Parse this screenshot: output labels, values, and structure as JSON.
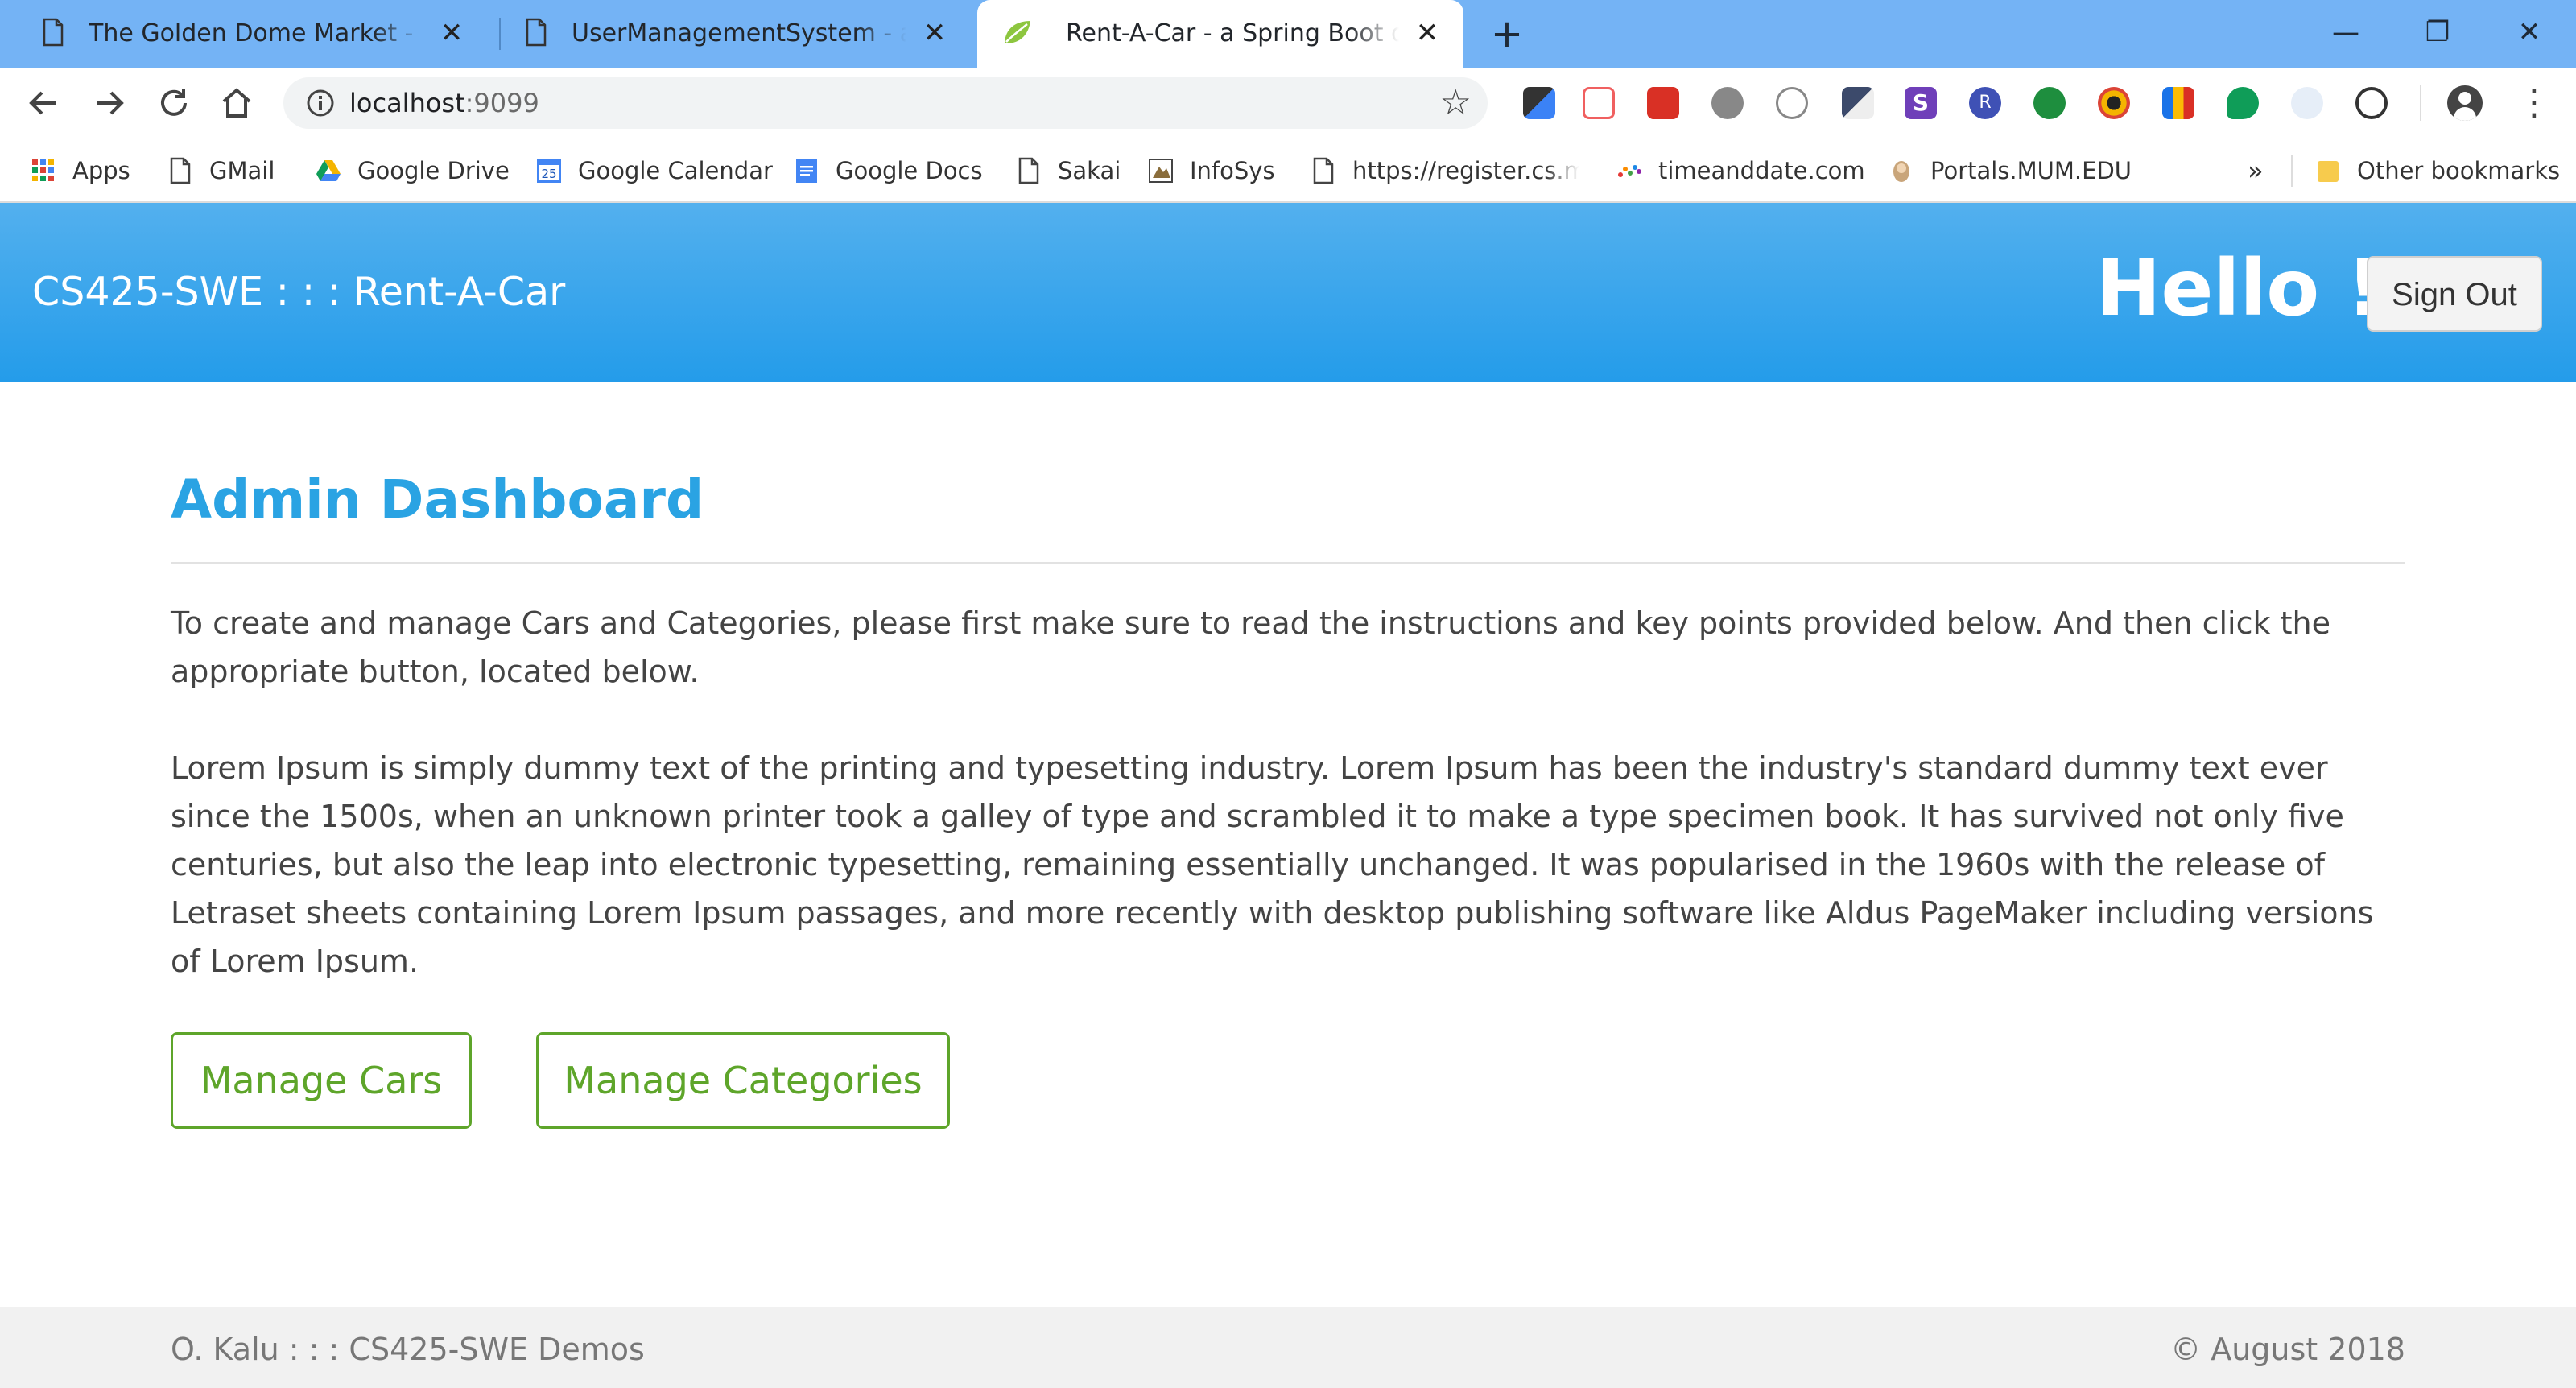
{
  "browser": {
    "tabs": [
      {
        "title": "The Golden Dome Market - SRM",
        "close": "✕"
      },
      {
        "title": "UserManagementSystem - a cust",
        "close": "✕"
      },
      {
        "title": "Rent-A-Car - a Spring Boot demo",
        "close": "✕",
        "active": true
      }
    ],
    "new_tab": "+",
    "window_controls": {
      "minimize": "—",
      "restore": "❐",
      "close": "✕"
    },
    "address": {
      "host": "localhost",
      "port": ":9099"
    },
    "bookmarks": [
      {
        "label": "Apps",
        "icon": "apps-grid-icon"
      },
      {
        "label": "GMail",
        "icon": "page-icon"
      },
      {
        "label": "Google Drive",
        "icon": "google-drive-icon"
      },
      {
        "label": "Google Calendar",
        "icon": "google-calendar-icon",
        "badge": "25"
      },
      {
        "label": "Google Docs",
        "icon": "google-docs-icon"
      },
      {
        "label": "Sakai",
        "icon": "page-icon"
      },
      {
        "label": "InfoSys",
        "icon": "infosys-icon"
      },
      {
        "label": "https://register.cs.mu",
        "icon": "page-icon"
      },
      {
        "label": "timeanddate.com",
        "icon": "timeanddate-icon"
      },
      {
        "label": "Portals.MUM.EDU",
        "icon": "portal-icon"
      }
    ],
    "bookmarks_more": "»",
    "other_bookmarks": "Other bookmarks",
    "menu": "⋮"
  },
  "navbar": {
    "brand": "CS425-SWE : : : Rent-A-Car",
    "greeting": "Hello !",
    "signout": "Sign Out"
  },
  "main": {
    "title": "Admin Dashboard",
    "intro": "To create and manage Cars and Categories, please first make sure to read the instructions and key points provided below. And then click the appropriate button, located below.",
    "lorem": "Lorem Ipsum is simply dummy text of the printing and typesetting industry. Lorem Ipsum has been the industry's standard dummy text ever since the 1500s, when an unknown printer took a galley of type and scrambled it to make a type specimen book. It has survived not only five centuries, but also the leap into electronic typesetting, remaining essentially unchanged. It was popularised in the 1960s with the release of Letraset sheets containing Lorem Ipsum passages, and more recently with desktop publishing software like Aldus PageMaker including versions of Lorem Ipsum.",
    "buttons": {
      "cars": "Manage Cars",
      "categories": "Manage Categories"
    }
  },
  "footer": {
    "left": "O. Kalu : : : CS425-SWE Demos",
    "right": "© August 2018"
  },
  "colors": {
    "tabstrip": "#74b3f5",
    "navbar_top": "#53b0ee",
    "navbar_bottom": "#249cea",
    "title": "#2aa3e3",
    "button_green": "#5ea52a"
  }
}
